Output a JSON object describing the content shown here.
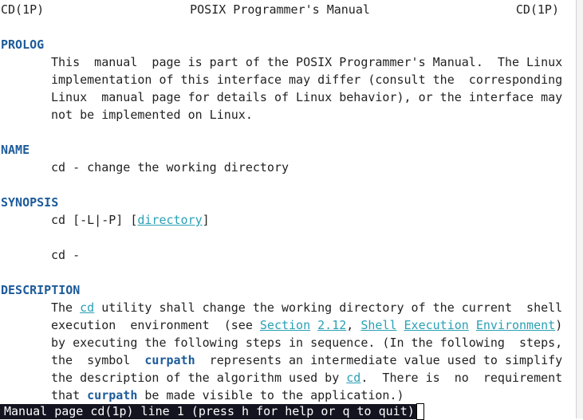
{
  "header": {
    "left": "CD(1P)",
    "center": "POSIX Programmer's Manual",
    "right": "CD(1P)"
  },
  "colors": {
    "section": "#1d5b9a",
    "link": "#2aa0b5",
    "status_bg": "#141420"
  },
  "lines": [
    {
      "seg": [
        {
          "t": "PROLOG",
          "s": "sec"
        }
      ]
    },
    {
      "ind": true,
      "seg": [
        {
          "t": "This  manual  page is part of the POSIX Programmer's Manual.  The Linux"
        }
      ]
    },
    {
      "ind": true,
      "seg": [
        {
          "t": "implementation of this interface may differ (consult the  corresponding"
        }
      ]
    },
    {
      "ind": true,
      "seg": [
        {
          "t": "Linux  manual page for details of Linux behavior), or the interface may"
        }
      ]
    },
    {
      "ind": true,
      "seg": [
        {
          "t": "not be implemented on Linux."
        }
      ]
    },
    {
      "seg": []
    },
    {
      "seg": [
        {
          "t": "NAME",
          "s": "sec"
        }
      ]
    },
    {
      "ind": true,
      "seg": [
        {
          "t": "cd - change the working directory"
        }
      ]
    },
    {
      "seg": []
    },
    {
      "seg": [
        {
          "t": "SYNOPSIS",
          "s": "sec"
        }
      ]
    },
    {
      "ind": true,
      "seg": [
        {
          "t": "cd [-L|-P] ["
        },
        {
          "t": "directory",
          "s": "lnk"
        },
        {
          "t": "]"
        }
      ]
    },
    {
      "seg": []
    },
    {
      "ind": true,
      "seg": [
        {
          "t": "cd -"
        }
      ]
    },
    {
      "seg": []
    },
    {
      "seg": [
        {
          "t": "DESCRIPTION",
          "s": "sec"
        }
      ]
    },
    {
      "ind": true,
      "seg": [
        {
          "t": "The "
        },
        {
          "t": "cd",
          "s": "lnk"
        },
        {
          "t": " utility shall change the working directory of the current  shell"
        }
      ]
    },
    {
      "ind": true,
      "seg": [
        {
          "t": "execution  environment  (see "
        },
        {
          "t": "Section",
          "s": "lnk"
        },
        {
          "t": " "
        },
        {
          "t": "2.12",
          "s": "lnk"
        },
        {
          "t": ", "
        },
        {
          "t": "Shell",
          "s": "lnk"
        },
        {
          "t": " "
        },
        {
          "t": "Execution",
          "s": "lnk"
        },
        {
          "t": " "
        },
        {
          "t": "Environment",
          "s": "lnk"
        },
        {
          "t": ")"
        }
      ]
    },
    {
      "ind": true,
      "seg": [
        {
          "t": "by executing the following steps in sequence. (In the following  steps,"
        }
      ]
    },
    {
      "ind": true,
      "seg": [
        {
          "t": "the  symbol  "
        },
        {
          "t": "curpath",
          "s": "kw"
        },
        {
          "t": "  represents an intermediate value used to simplify"
        }
      ]
    },
    {
      "ind": true,
      "seg": [
        {
          "t": "the description of the algorithm used by "
        },
        {
          "t": "cd",
          "s": "lnk"
        },
        {
          "t": ".  There is  no  requirement"
        }
      ]
    },
    {
      "ind": true,
      "seg": [
        {
          "t": "that "
        },
        {
          "t": "curpath",
          "s": "kw"
        },
        {
          "t": " be made visible to the application.)"
        }
      ]
    }
  ],
  "status": "Manual page cd(1p) line 1 (press h for help or q to quit)"
}
